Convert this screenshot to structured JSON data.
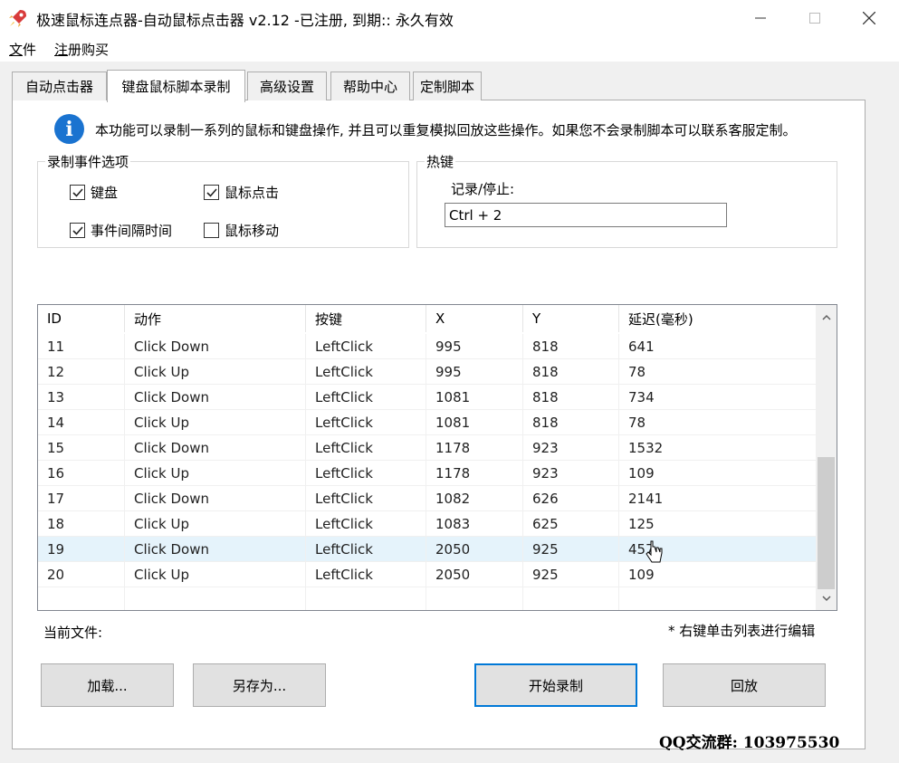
{
  "window": {
    "title": "极速鼠标连点器-自动鼠标点击器 v2.12  -已注册, 到期:: 永久有效"
  },
  "menu": [
    "文件",
    "注册购买"
  ],
  "tabs": [
    "自动点击器",
    "键盘鼠标脚本录制",
    "高级设置",
    "帮助中心",
    "定制脚本"
  ],
  "active_tab": 1,
  "info": {
    "text": "本功能可以录制一系列的鼠标和键盘操作, 并且可以重复模拟回放这些操作。如果您不会录制脚本可以联系客服定制。"
  },
  "record_options": {
    "title": "录制事件选项",
    "items": [
      {
        "label": "键盘",
        "checked": true
      },
      {
        "label": "鼠标点击",
        "checked": true
      },
      {
        "label": "事件间隔时间",
        "checked": true
      },
      {
        "label": "鼠标移动",
        "checked": false
      }
    ]
  },
  "hotkey": {
    "title": "热键",
    "label": "记录/停止:",
    "value": "Ctrl + 2"
  },
  "table": {
    "headers": [
      "ID",
      "动作",
      "按键",
      "X",
      "Y",
      "延迟(毫秒)"
    ],
    "rows": [
      [
        "11",
        "Click Down",
        "LeftClick",
        "995",
        "818",
        "641"
      ],
      [
        "12",
        "Click Up",
        "LeftClick",
        "995",
        "818",
        "78"
      ],
      [
        "13",
        "Click Down",
        "LeftClick",
        "1081",
        "818",
        "734"
      ],
      [
        "14",
        "Click Up",
        "LeftClick",
        "1081",
        "818",
        "78"
      ],
      [
        "15",
        "Click Down",
        "LeftClick",
        "1178",
        "923",
        "1532"
      ],
      [
        "16",
        "Click Up",
        "LeftClick",
        "1178",
        "923",
        "109"
      ],
      [
        "17",
        "Click Down",
        "LeftClick",
        "1082",
        "626",
        "2141"
      ],
      [
        "18",
        "Click Up",
        "LeftClick",
        "1083",
        "625",
        "125"
      ],
      [
        "19",
        "Click Down",
        "LeftClick",
        "2050",
        "925",
        "457"
      ],
      [
        "20",
        "Click Up",
        "LeftClick",
        "2050",
        "925",
        "109"
      ]
    ],
    "selected_row": 8
  },
  "current_file": {
    "label": "当前文件:"
  },
  "note": "* 右键单击列表进行编辑",
  "buttons": {
    "load": "加载...",
    "save_as": "另存为...",
    "start_record": "开始录制",
    "playback": "回放"
  },
  "qq_group": "QQ交流群:  103975530",
  "colors": {
    "accent": "#0078d7",
    "info_icon": "#1a73d0",
    "selected_row": "#e5f3fb"
  }
}
